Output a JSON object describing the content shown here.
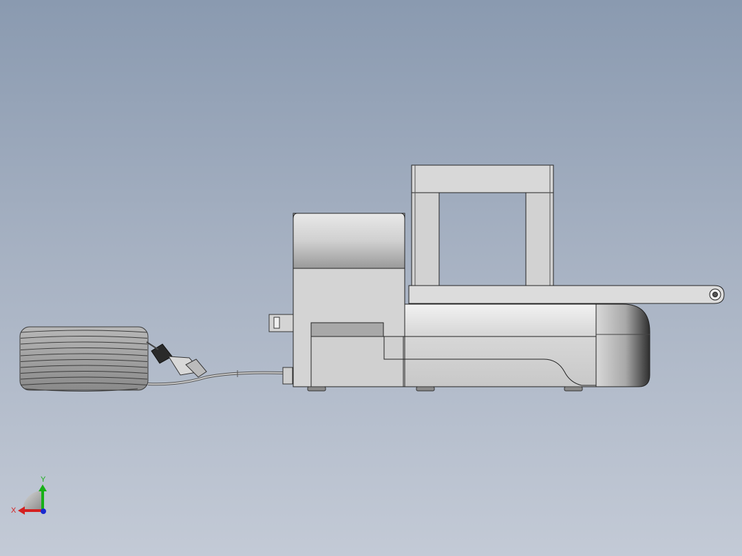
{
  "viewport": {
    "background_top": "#8a9ab0",
    "background_bottom": "#c3cad6"
  },
  "model": {
    "parts": [
      "cable-coil",
      "cable-connector",
      "cable",
      "motor-housing",
      "side-mount-bracket",
      "base-body",
      "front-nose",
      "lifting-arm",
      "handle-frame",
      "feet"
    ]
  },
  "triad": {
    "x_label": "X",
    "y_label": "Y",
    "x_color": "#d42020",
    "y_color": "#18b018",
    "z_color": "#1a2ad0"
  }
}
